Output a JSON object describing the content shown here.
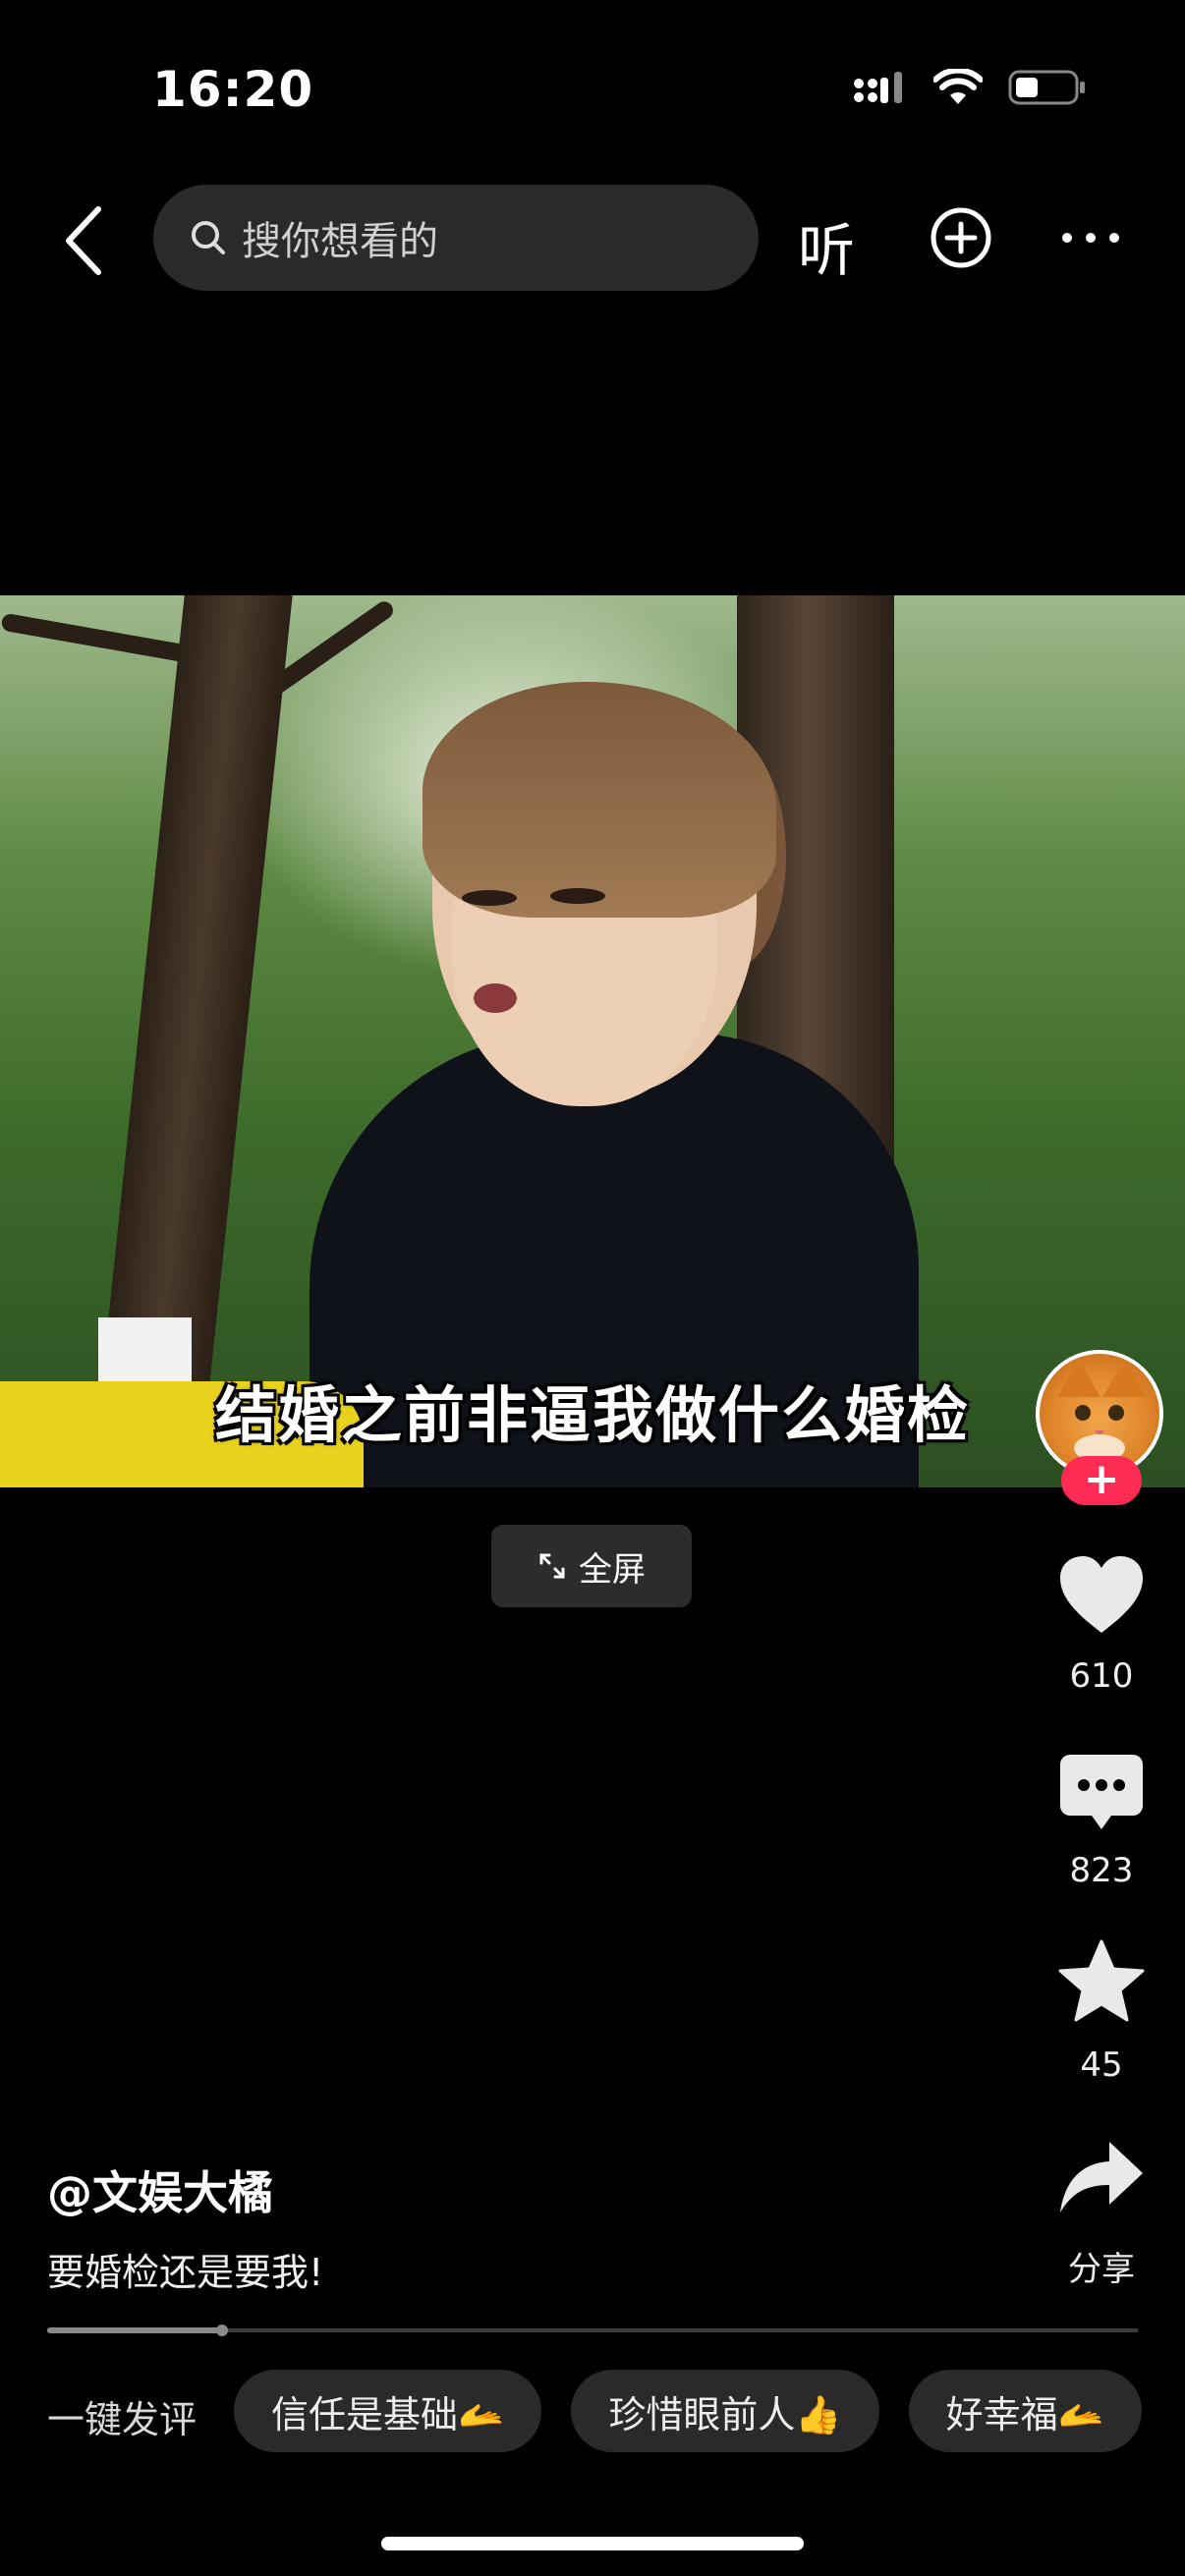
{
  "status_bar": {
    "time": "16:20"
  },
  "top_bar": {
    "search_placeholder": "搜你想看的",
    "listen_label": "听"
  },
  "video": {
    "subtitle": "结婚之前非逼我做什么婚检"
  },
  "fullscreen_label": "全屏",
  "actions": {
    "likes": "610",
    "comments": "823",
    "favorites": "45",
    "share_label": "分享"
  },
  "post": {
    "author": "@文娱大橘",
    "description": "要婚检还是要我!"
  },
  "playback_progress": 0.16,
  "quick_comment": {
    "label": "一键发评",
    "chips": [
      "信任是基础🫴",
      "珍惜眼前人👍",
      "好幸福🫴"
    ]
  }
}
